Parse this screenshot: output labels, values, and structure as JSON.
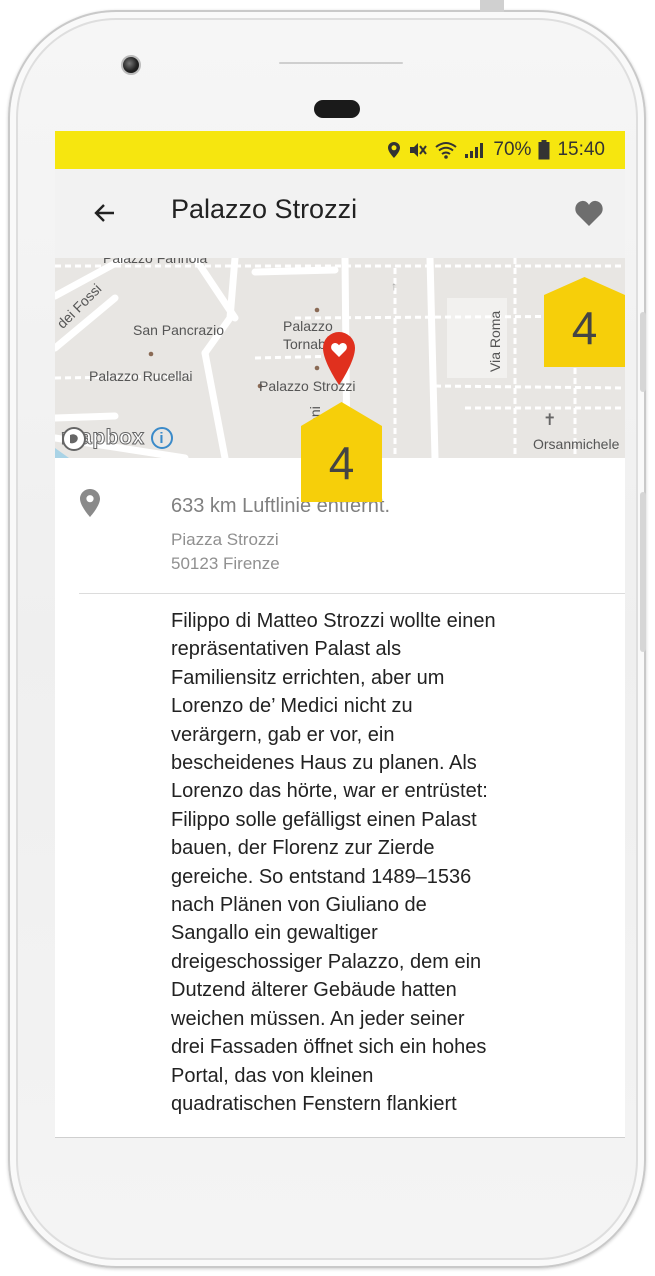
{
  "status_bar": {
    "battery": "70%",
    "time": "15:40"
  },
  "app_bar": {
    "title": "Palazzo Strozzi",
    "back_icon": "arrow-left-icon",
    "favorite_icon": "heart-icon"
  },
  "map": {
    "labels": {
      "palazzo_farinola": "Palazzo Farinola",
      "dei_fossi": "dei Fossi",
      "san_pancrazio": "San Pancrazio",
      "palazzo_tornabuoni_1": "Palazzo",
      "palazzo_tornabuoni_2": "Tornab",
      "palazzo_rucellai": "Palazzo Rucellai",
      "palazzo_strozzi": "Palazzo Strozzi",
      "via_roma": "Via Roma",
      "orsanmichele": "Orsanmichele",
      "tornabuoni_vertical": "nabuoni"
    },
    "attribution": "mapbox",
    "marker_icon": "map-marker-heart-icon"
  },
  "callouts": {
    "favorite": "4",
    "marker": "4"
  },
  "location": {
    "distance": "633 km Luftlinie entfernt.",
    "street": "Piazza Strozzi",
    "city": "50123 Firenze",
    "icon": "location-pin-icon"
  },
  "description": "Filippo di Matteo Strozzi wollte einen\nrepräsentativen Palast als\nFamiliensitz errichten, aber um\nLorenzo de’ Medici nicht zu\nverärgern, gab er vor, ein\nbescheidenes Haus zu planen. Als\nLorenzo das hörte, war er entrüstet:\nFilippo solle gefälligst einen Palast\nbauen, der Florenz zur Zierde\ngereiche. So entstand 1489–1536\nnach Plänen von Giuliano de\nSangallo ein gewaltiger\ndreigeschossiger Palazzo, dem ein\nDutzend älterer Gebäude hatten\nweichen müssen. An jeder seiner\ndrei Fassaden öffnet sich ein hohes\nPortal, das von kleinen\nquadratischen Fenstern flankiert",
  "colors": {
    "status_bar": "#f6e60f",
    "callout": "#f6cf0a",
    "marker": "#e0301e",
    "icon_gray": "#8a8a8a"
  }
}
